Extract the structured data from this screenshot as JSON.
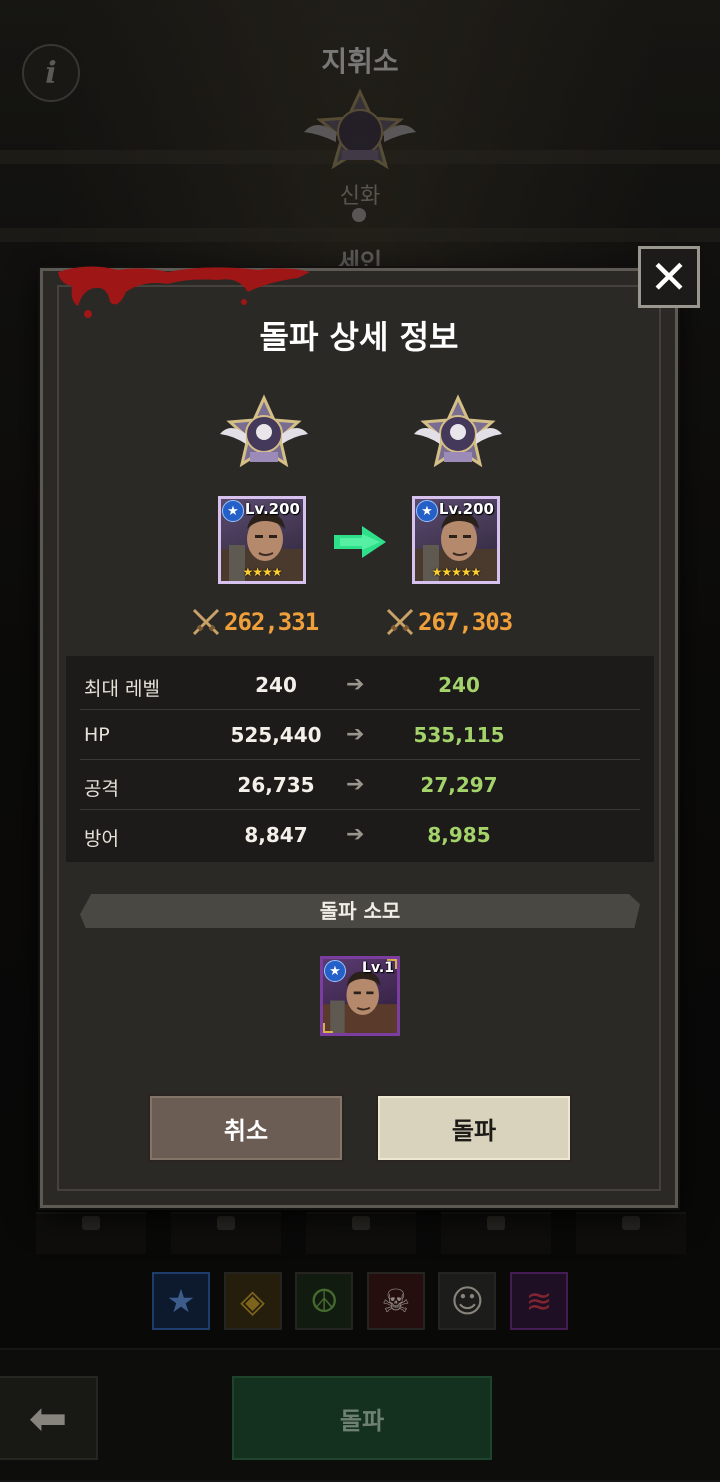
{
  "background": {
    "title": "지휘소",
    "rank_label": "신화",
    "hero_name": "세인",
    "info_label": "i",
    "bottom_button": "돌파",
    "class_icons": [
      "star-icon",
      "tiger-icon",
      "peace-icon",
      "skull-icon",
      "woman-icon",
      "bandana-icon"
    ]
  },
  "dialog": {
    "title": "돌파 상세 정보",
    "close_label": "✕",
    "before": {
      "level": "Lv.200",
      "stars": "★★★★",
      "power": "262,331"
    },
    "after": {
      "level": "Lv.200",
      "stars": "★★★★★",
      "power": "267,303"
    },
    "stats": [
      {
        "label": "최대 레벨",
        "current": "240",
        "next": "240"
      },
      {
        "label": "HP",
        "current": "525,440",
        "next": "535,115"
      },
      {
        "label": "공격",
        "current": "26,735",
        "next": "27,297"
      },
      {
        "label": "방어",
        "current": "8,847",
        "next": "8,985"
      }
    ],
    "consume_title": "돌파 소모",
    "consume_hero": {
      "level": "Lv.1"
    },
    "cancel_label": "취소",
    "confirm_label": "돌파"
  },
  "colors": {
    "power": "#f0a03a",
    "next_value": "#a3d36a",
    "arrow_green": "#2fe08a",
    "stars": "#ffcf30"
  }
}
